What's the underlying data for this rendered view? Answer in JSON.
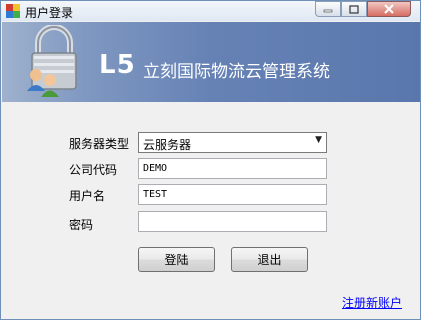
{
  "window": {
    "title": "用户登录",
    "icons": {
      "app": "app-icon",
      "minimize": "minimize-icon",
      "maximize": "maximize-icon",
      "close": "close-icon"
    }
  },
  "banner": {
    "logo_mark": "L5",
    "system_name": "立刻国际物流云管理系统",
    "icon": "lock-users-icon"
  },
  "form": {
    "server_type_label": "服务器类型",
    "server_type_value": "云服务器",
    "company_code_label": "公司代码",
    "company_code_value": "DEMO",
    "username_label": "用户名",
    "username_value": "TEST",
    "password_label": "密码",
    "password_value": ""
  },
  "actions": {
    "login_label": "登陆",
    "exit_label": "退出",
    "register_link": "注册新账户"
  }
}
